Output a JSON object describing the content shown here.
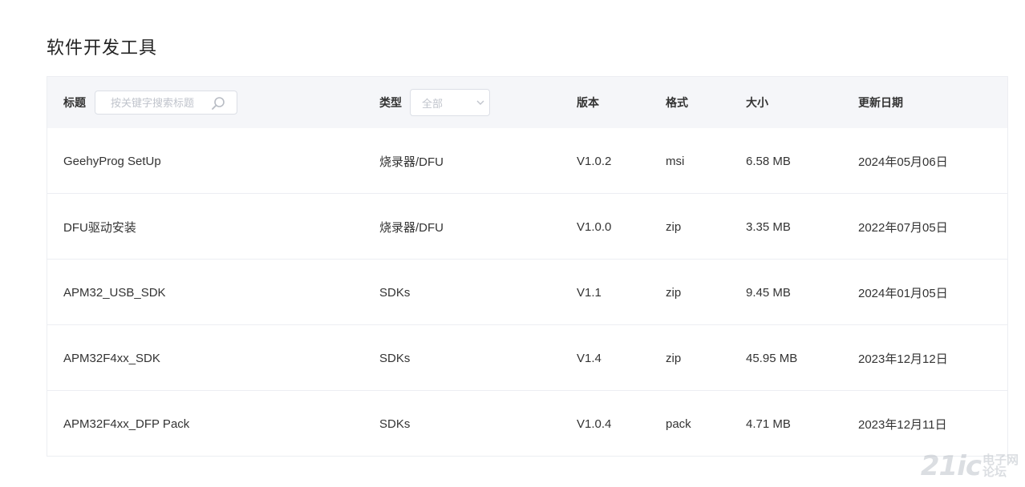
{
  "page": {
    "title": "软件开发工具"
  },
  "table": {
    "headers": {
      "title": "标题",
      "type": "类型",
      "version": "版本",
      "format": "格式",
      "size": "大小",
      "date": "更新日期"
    },
    "search": {
      "placeholder": "按关键字搜索标题",
      "value": ""
    },
    "type_filter": {
      "selected": "全部"
    },
    "rows": [
      {
        "title": "GeehyProg SetUp",
        "type": "烧录器/DFU",
        "version": "V1.0.2",
        "format": "msi",
        "size": "6.58 MB",
        "date": "2024年05月06日"
      },
      {
        "title": "DFU驱动安装",
        "type": "烧录器/DFU",
        "version": "V1.0.0",
        "format": "zip",
        "size": "3.35 MB",
        "date": "2022年07月05日"
      },
      {
        "title": "APM32_USB_SDK",
        "type": "SDKs",
        "version": "V1.1",
        "format": "zip",
        "size": "9.45 MB",
        "date": "2024年01月05日"
      },
      {
        "title": "APM32F4xx_SDK",
        "type": "SDKs",
        "version": "V1.4",
        "format": "zip",
        "size": "45.95 MB",
        "date": "2023年12月12日"
      },
      {
        "title": "APM32F4xx_DFP Pack",
        "type": "SDKs",
        "version": "V1.0.4",
        "format": "pack",
        "size": "4.71 MB",
        "date": "2023年12月11日"
      }
    ]
  },
  "watermark": {
    "logo": "21ic",
    "line1": "电子网",
    "line2": "论坛"
  },
  "icons": {
    "search": "search-icon",
    "chevron": "chevron-down-icon"
  }
}
